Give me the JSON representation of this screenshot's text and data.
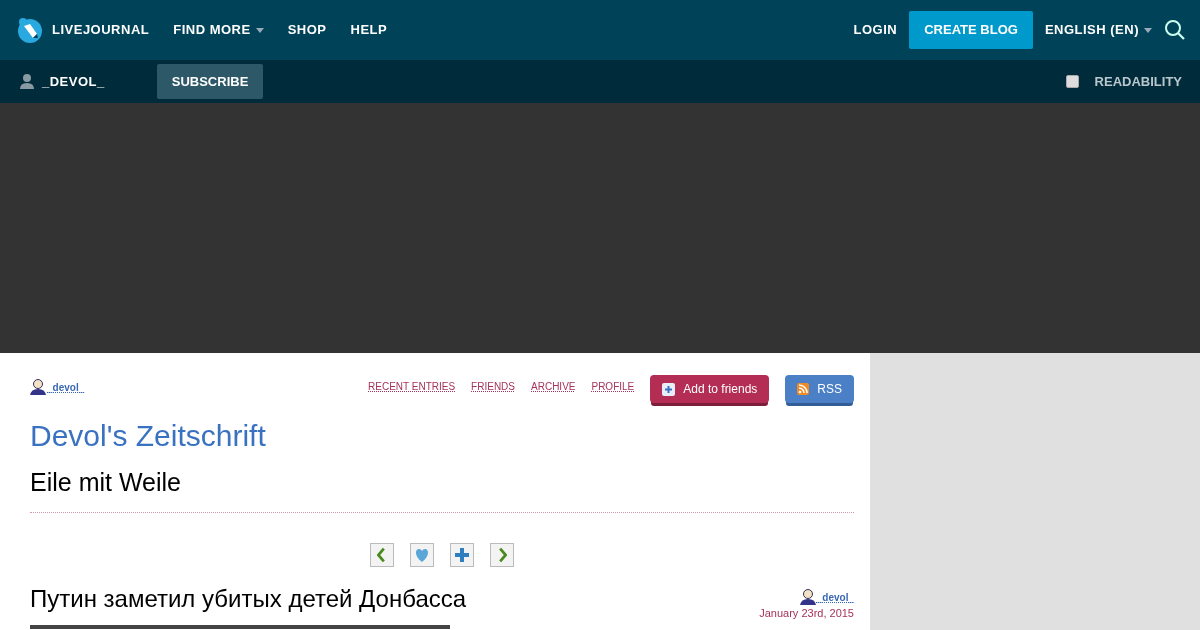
{
  "top_nav": {
    "logo": "LIVEJOURNAL",
    "items": [
      {
        "label": "FIND MORE",
        "dropdown": true
      },
      {
        "label": "SHOP",
        "dropdown": false
      },
      {
        "label": "HELP",
        "dropdown": false
      }
    ],
    "login": "LOGIN",
    "create_blog": "CREATE BLOG",
    "language": "ENGLISH (EN)"
  },
  "sub_nav": {
    "user": "_DEVOL_",
    "subscribe": "SUBSCRIBE",
    "readability": {
      "label": "READABILITY",
      "checked": false
    }
  },
  "journal": {
    "user": "_devol_",
    "links": [
      "RECENT ENTRIES",
      "FRIENDS",
      "ARCHIVE",
      "PROFILE"
    ],
    "add_friends": "Add to friends",
    "rss": "RSS",
    "title": "Devol's Zeitschrift",
    "subtitle": "Eile mit Weile"
  },
  "entry_nav": [
    {
      "kind": "prev"
    },
    {
      "kind": "memories"
    },
    {
      "kind": "tell"
    },
    {
      "kind": "next"
    }
  ],
  "entry": {
    "title": "Путин заметил убитых детей Донбасса",
    "user": "_devol_",
    "date": "January 23rd, 2015"
  }
}
